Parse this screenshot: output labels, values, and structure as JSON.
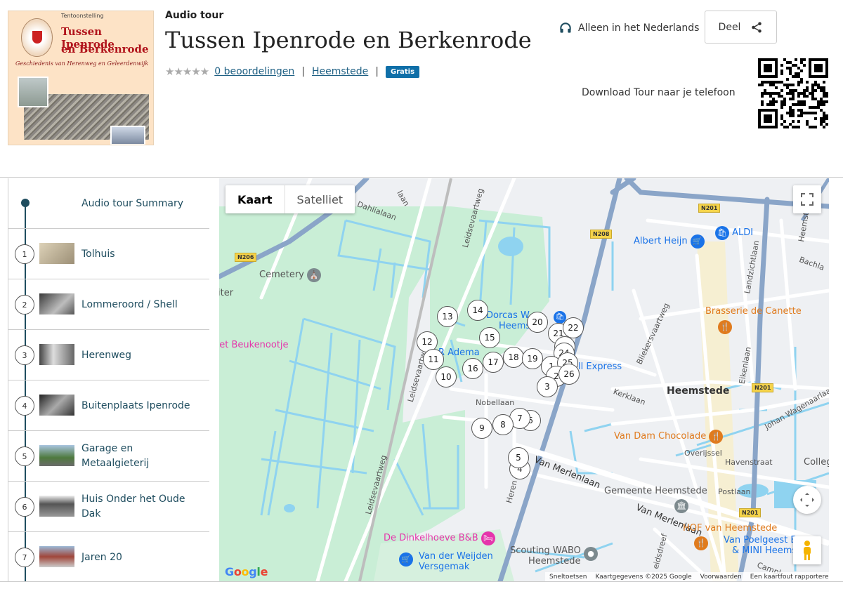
{
  "cover": {
    "small": "Tentoonstelling",
    "title1": "Tussen Ipenrode",
    "title2": "en Berkenrode",
    "subtitle": "Geschiedenis van Herenweg en Geleerdenwijk"
  },
  "header": {
    "eyebrow": "Audio tour",
    "title": "Tussen Ipenrode en Berkenrode",
    "stars": "★★★★★",
    "ratings_link": "0 beoordelingen",
    "separator": "|",
    "location_link": "Heemstede",
    "badge": "Gratis",
    "language": "Alleen in het Nederlands",
    "share_label": "Deel",
    "download": "Download Tour naar je telefoon"
  },
  "sidebar": {
    "items": [
      {
        "label": "Audio tour Summary"
      },
      {
        "num": "1",
        "label": "Tolhuis"
      },
      {
        "num": "2",
        "label": "Lommeroord / Shell"
      },
      {
        "num": "3",
        "label": "Herenweg"
      },
      {
        "num": "4",
        "label": "Buitenplaats Ipenrode"
      },
      {
        "num": "5",
        "label": "Garage en Metaalgieterij"
      },
      {
        "num": "6",
        "label": "Huis Onder het Oude Dak"
      },
      {
        "num": "7",
        "label": "Jaren 20"
      }
    ]
  },
  "map": {
    "type_map": "Kaart",
    "type_satellite": "Satelliet",
    "markers": [
      "1",
      "2",
      "3",
      "4",
      "5",
      "6",
      "7",
      "8",
      "9",
      "10",
      "11",
      "12",
      "13",
      "14",
      "15",
      "16",
      "17",
      "18",
      "19",
      "20",
      "21",
      "22",
      "23",
      "24",
      "25",
      "26"
    ],
    "pois": {
      "cemetery": "Cemetery",
      "albert_heijn": "Albert Heijn",
      "aldi": "ALDI",
      "dorcas": "Dorcas W",
      "heems": "Heems",
      "brasserie": "Brasserie de Canette",
      "beukenootje": "het Beukenootje",
      "r_adema": "R Adema",
      "ell_express": "ell Express",
      "heemstede": "Heemstede",
      "van_dam": "Van Dam Chocolade",
      "colleg": "Colleg",
      "gemeente": "Gemeente Heemstede",
      "hof": "HOF van Heemstede",
      "van_poelgeest": "Van Poelgeest B",
      "mini_heems": "& MINI Heems",
      "dinkelhoeve": "De Dinkelhoeve B&B",
      "van_der_weijden_1": "Van der Weijden",
      "van_der_weijden_2": "Versgemak",
      "scouting_1": "Scouting WABO",
      "scouting_2": "Heemstede",
      "iter": "iter"
    },
    "roads": {
      "n206": "N206",
      "n208": "N208",
      "n201_a": "N201",
      "n201_b": "N201",
      "n201_c": "N201",
      "dahlialaan": "Dahlialaan",
      "laan": "laan",
      "leidsevaartweg_1": "Leidsevaartweg",
      "leidsevaartweg_2": "Leidsevaartweg",
      "leidsevaartweg_3": "Leidsevaartweg",
      "heemstedse": "Heemstedse",
      "landzichtlaan": "Landzichtlaan",
      "bachla": "Bachla",
      "bliekersvaartweg": "Bliekersvaartweg",
      "eikenlaan": "Eikenlaan",
      "kerklaan": "Kerklaan",
      "nobellaan": "Nobellaan",
      "johan": "Johan Wagenaarlaan",
      "overijssel": "Overijssel",
      "havenstraat": "Havenstraat",
      "postlaan": "Postlaan",
      "van_merlenlaan_1": "Van Merlenlaan",
      "van_merlenlaan_2": "Van Merlenlaan",
      "herenweg": "Heren",
      "heidsdreef": "eidsdreef",
      "campl": "Campl"
    },
    "footer": {
      "shortcuts": "Sneltoetsen",
      "data": "Kaartgegevens ©2025 Google",
      "terms": "Voorwaarden",
      "report": "Een kaartfout rapporteren"
    },
    "logo": "Google"
  },
  "colors": {
    "accent": "#1f4d5f",
    "link": "#1d5f83",
    "badge": "#0f6fa8",
    "park": "#c9eed6",
    "water": "#8fd3f0",
    "road_major": "#8aa5c8",
    "poi_orange": "#e07b1e",
    "poi_blue": "#1a73e8",
    "poi_pink": "#e535ab"
  }
}
